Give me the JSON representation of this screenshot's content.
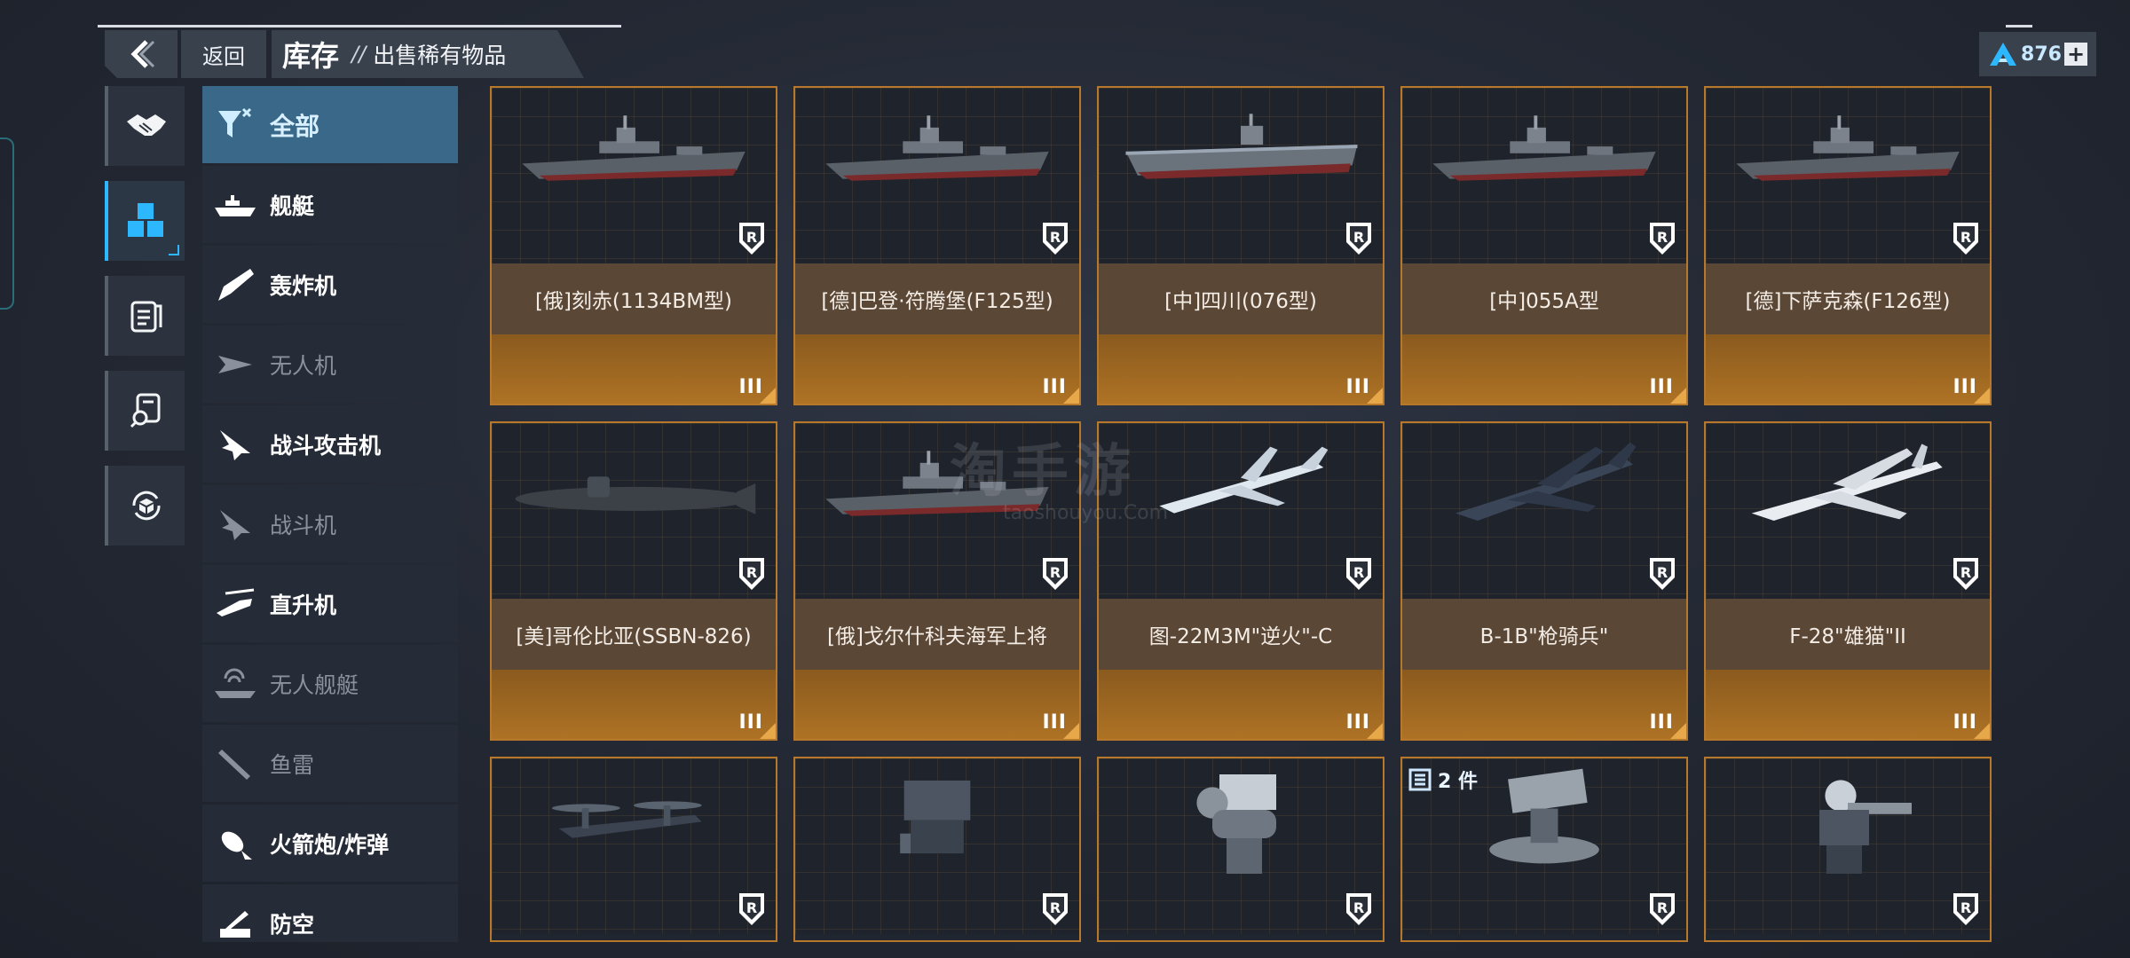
{
  "header": {
    "back_label": "返回",
    "title": "库存",
    "separator": "//",
    "subtitle": "出售稀有物品"
  },
  "currency": {
    "value": "876"
  },
  "rail": [
    "handshake-icon",
    "inventory-cubes-icon",
    "document-list-icon",
    "search-doc-icon",
    "refresh-box-icon"
  ],
  "categories": [
    {
      "label": "全部",
      "icon": "all-filter-icon",
      "state": "selected"
    },
    {
      "label": "舰艇",
      "icon": "ship-icon",
      "state": "normal"
    },
    {
      "label": "轰炸机",
      "icon": "bomber-icon",
      "state": "normal"
    },
    {
      "label": "无人机",
      "icon": "drone-icon",
      "state": "dim"
    },
    {
      "label": "战斗攻击机",
      "icon": "attack-jet-icon",
      "state": "normal"
    },
    {
      "label": "战斗机",
      "icon": "fighter-icon",
      "state": "dim"
    },
    {
      "label": "直升机",
      "icon": "helicopter-icon",
      "state": "normal"
    },
    {
      "label": "无人舰艇",
      "icon": "unmanned-boat-icon",
      "state": "dim"
    },
    {
      "label": "鱼雷",
      "icon": "torpedo-icon",
      "state": "dim"
    },
    {
      "label": "火箭炮/炸弹",
      "icon": "rocket-bomb-icon",
      "state": "normal"
    },
    {
      "label": "防空",
      "icon": "anti-air-icon",
      "state": "normal"
    }
  ],
  "items": [
    {
      "name": "[俄]刻赤(1134BM型)",
      "tier": "III",
      "kind": "ship"
    },
    {
      "name": "[德]巴登·符腾堡(F125型)",
      "tier": "III",
      "kind": "ship"
    },
    {
      "name": "[中]四川(076型)",
      "tier": "III",
      "kind": "carrier"
    },
    {
      "name": "[中]055A型",
      "tier": "III",
      "kind": "ship"
    },
    {
      "name": "[德]下萨克森(F126型)",
      "tier": "III",
      "kind": "ship"
    },
    {
      "name": "[美]哥伦比亚(SSBN-826)",
      "tier": "III",
      "kind": "sub"
    },
    {
      "name": "[俄]戈尔什科夫海军上将",
      "tier": "III",
      "kind": "ship"
    },
    {
      "name": "图-22M3M\"逆火\"-C",
      "tier": "III",
      "kind": "bomber"
    },
    {
      "name": "B-1B\"枪骑兵\"",
      "tier": "III",
      "kind": "bomber-dark"
    },
    {
      "name": "F-28\"雄猫\"II",
      "tier": "III",
      "kind": "fighter"
    },
    {
      "name": "",
      "tier": "",
      "kind": "tiltrotor"
    },
    {
      "name": "",
      "tier": "",
      "kind": "launcher"
    },
    {
      "name": "",
      "tier": "",
      "kind": "ciws"
    },
    {
      "name": "",
      "tier": "",
      "kind": "rocket-pod",
      "count": "2 件"
    },
    {
      "name": "",
      "tier": "",
      "kind": "gatling"
    }
  ],
  "watermark": {
    "main": "淘手游",
    "sub": "taoshouyou.Com"
  }
}
